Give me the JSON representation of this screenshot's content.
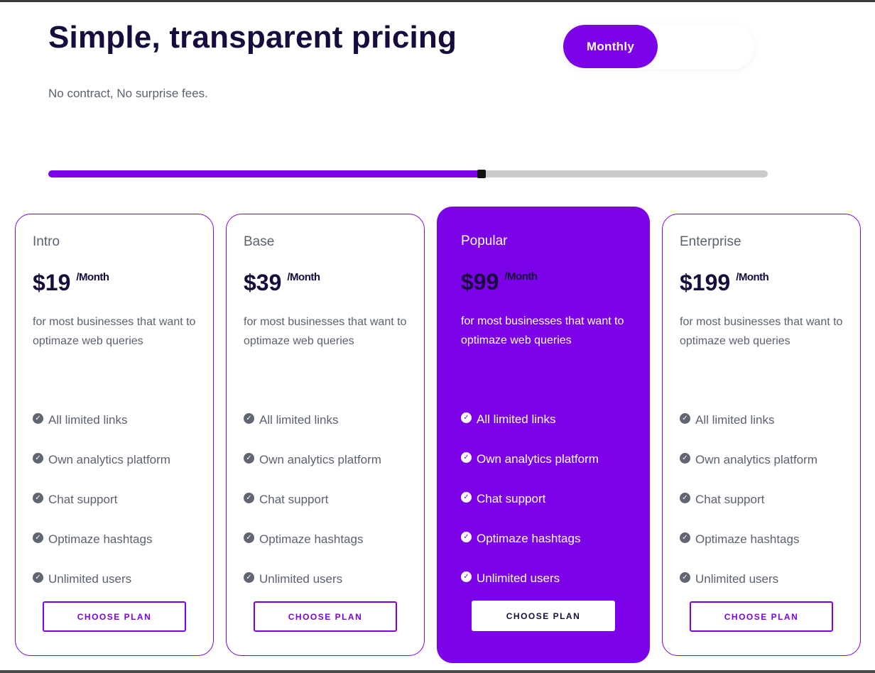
{
  "header": {
    "title": "Simple, transparent pricing",
    "subtitle": "No contract, No surprise fees."
  },
  "billing_toggle": {
    "active_label": "Monthly",
    "accent_color": "#7c03e8"
  },
  "progress": {
    "fraction": 0.602
  },
  "plans": [
    {
      "name": "Intro",
      "price": "$19",
      "period": "/Month",
      "description": "for most businesses that want to optimaze web queries",
      "features": [
        "All limited links",
        "Own analytics platform",
        "Chat support",
        "Optimaze hashtags",
        "Unlimited users"
      ],
      "button": "CHOOSE PLAN"
    },
    {
      "name": "Base",
      "price": "$39",
      "period": "/Month",
      "description": "for most businesses that want to optimaze web queries",
      "features": [
        "All limited links",
        "Own analytics platform",
        "Chat support",
        "Optimaze hashtags",
        "Unlimited users"
      ],
      "button": "CHOOSE PLAN"
    },
    {
      "name": "Popular",
      "price": "$99",
      "period": "/Month",
      "description": "for most businesses that want to optimaze web queries",
      "features": [
        "All limited links",
        "Own analytics platform",
        "Chat support",
        "Optimaze hashtags",
        "Unlimited users"
      ],
      "button": "CHOOSE PLAN",
      "highlighted": true
    },
    {
      "name": "Enterprise",
      "price": "$199",
      "period": "/Month",
      "description": "for most businesses that want to optimaze web queries",
      "features": [
        "All limited links",
        "Own analytics platform",
        "Chat support",
        "Optimaze hashtags",
        "Unlimited users"
      ],
      "button": "CHOOSE PLAN"
    }
  ],
  "icons": {
    "feature": "check-circle-icon"
  },
  "colors": {
    "accent": "#7c03e8",
    "heading": "#180b3d",
    "body_text": "#5a6170",
    "track": "#cbcbcb"
  }
}
